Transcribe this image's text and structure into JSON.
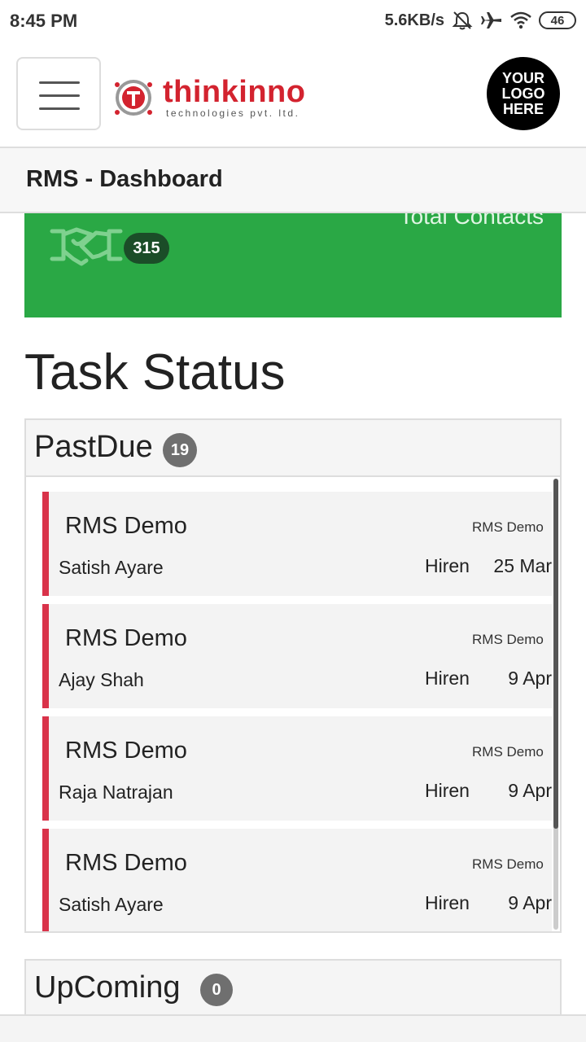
{
  "status_bar": {
    "time": "8:45 PM",
    "speed": "5.6KB/s",
    "battery": "46",
    "icons": [
      "mute-bell-icon",
      "airplane-icon",
      "wifi-icon",
      "battery-icon"
    ]
  },
  "header": {
    "logo_word": "thinkinno",
    "logo_sub": "technologies pvt. ltd.",
    "brand_logo_text": "YOUR\nLOGO\nHERE"
  },
  "page": {
    "title": "RMS - Dashboard"
  },
  "contacts_card": {
    "label": "Total Contacts",
    "count": "315",
    "icon": "handshake-icon",
    "color": "#2aa845"
  },
  "task_status": {
    "title": "Task Status",
    "past_due": {
      "title": "PastDue",
      "count": "19",
      "accent": "#d9334a",
      "tasks": [
        {
          "title": "RMS Demo",
          "person": "Satish Ayare",
          "project": "RMS Demo",
          "owner": "Hiren",
          "date": "25 Mar"
        },
        {
          "title": "RMS Demo",
          "person": "Ajay Shah",
          "project": "RMS Demo",
          "owner": "Hiren",
          "date": "9 Apr"
        },
        {
          "title": "RMS Demo",
          "person": "Raja Natrajan",
          "project": "RMS Demo",
          "owner": "Hiren",
          "date": "9 Apr"
        },
        {
          "title": "RMS Demo",
          "person": "Satish Ayare",
          "project": "RMS Demo",
          "owner": "Hiren",
          "date": "9 Apr"
        }
      ]
    },
    "upcoming": {
      "title": "UpComing",
      "count": "0"
    }
  }
}
